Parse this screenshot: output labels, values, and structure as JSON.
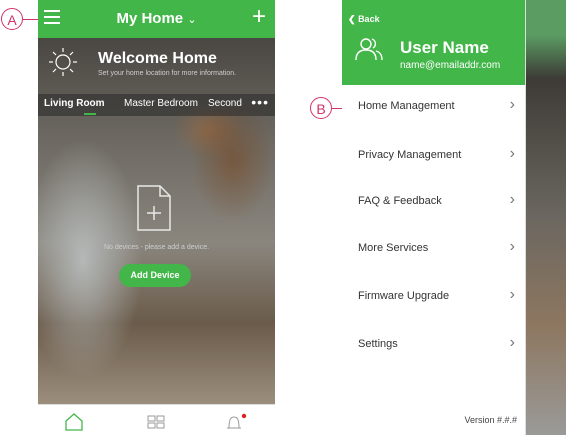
{
  "callouts": {
    "a": "A",
    "b": "B"
  },
  "home": {
    "title": "My Home",
    "welcome_title": "Welcome Home",
    "welcome_subtitle": "Set your home location for more information.",
    "rooms": [
      "Living Room",
      "Master Bedroom",
      "Second"
    ],
    "more": "•••",
    "empty_text": "No devices - please add a device.",
    "add_device_label": "Add Device"
  },
  "drawer": {
    "back_label": "Back",
    "user_name": "User Name",
    "user_email": "name@emailaddr.com",
    "menu_items": [
      "Home Management",
      "Privacy Management",
      "FAQ & Feedback",
      "More Services",
      "Firmware Upgrade",
      "Settings"
    ],
    "version": "Version #.#.#"
  },
  "colors": {
    "accent": "#42b649",
    "callout": "#d2336b",
    "notification_dot": "#e02020"
  }
}
